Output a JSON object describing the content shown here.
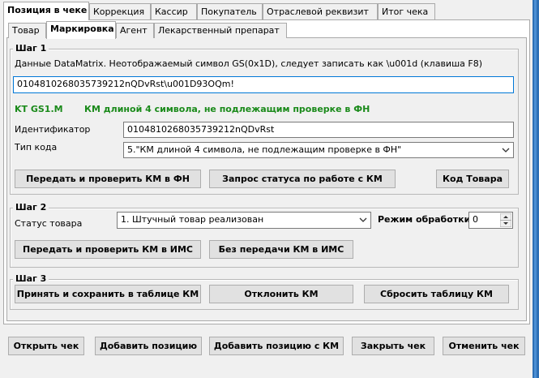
{
  "outer_tabs": [
    "Позиция в чеке",
    "Коррекция",
    "Кассир",
    "Покупатель",
    "Отраслевой реквизит",
    "Итог чека"
  ],
  "inner_tabs": [
    "Товар",
    "Маркировка",
    "Агент",
    "Лекарственный препарат"
  ],
  "step1": {
    "legend": "Шаг 1",
    "instruction": "Данные DataMatrix. Неотображаемый символ GS(0x1D), следует записать как \\u001d  (клавиша  F8)",
    "datamatrix_value": "0104810268035739212nQDvRst\\u001D93OQm!",
    "kt_label": "KT GS1.M",
    "kt_status": "КМ длиной 4 символа, не подлежащим проверке в ФН",
    "identifier_label": "Идентификатор",
    "identifier_value": "0104810268035739212nQDvRst",
    "code_type_label": "Тип кода",
    "code_type_value": "5.\"КМ длиной 4 символа, не подлежащим проверке в ФН\"",
    "btn_send_check_fn": "Передать и проверить КМ в ФН",
    "btn_status_request": "Запрос статуса по работе с  КМ",
    "btn_product_code": "Код Товара"
  },
  "step2": {
    "legend": "Шаг 2",
    "status_label": "Статус товара",
    "status_value": "1. Штучный товар реализован",
    "mode_label": "Режим обработки",
    "mode_value": "0",
    "btn_send_check_ims": "Передать и проверить КМ в ИМС",
    "btn_no_send_ims": "Без передачи КМ в ИМС"
  },
  "step3": {
    "legend": "Шаг 3",
    "btn_accept_save": "Принять и сохранить в таблице КМ",
    "btn_reject": "Отклонить КМ",
    "btn_reset_table": "Сбросить таблицу КМ"
  },
  "footer": {
    "open_receipt": "Открыть чек",
    "add_position": "Добавить позицию",
    "add_position_km": "Добавить позицию с КМ",
    "close_receipt": "Закрыть чек",
    "cancel_receipt": "Отменить чек"
  },
  "colors": {
    "accent_focus": "#0078d7",
    "status_green": "#1a8a1a",
    "window_side": "#2d6fb5"
  }
}
